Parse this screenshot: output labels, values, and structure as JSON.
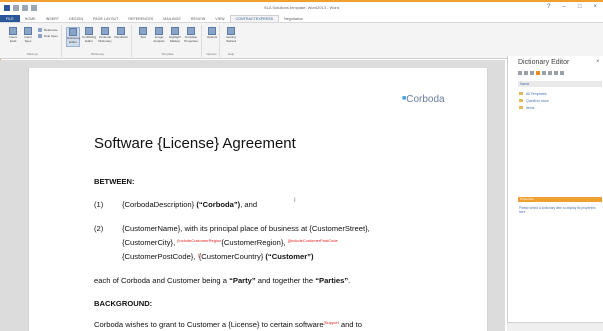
{
  "window": {
    "title": "SLA Solutions template: Word2013 - Word"
  },
  "tabs": [
    "FILE",
    "HOME",
    "INSERT",
    "DESIGN",
    "PAGE LAYOUT",
    "REFERENCES",
    "MAILINGS",
    "REVIEW",
    "VIEW",
    "CONTRACTEXPRESS",
    "Negotiation"
  ],
  "ribbon": {
    "groups": [
      {
        "label": "Mark-up",
        "buttons": [
          "Insert Field",
          "Insert Spec"
        ],
        "small": [
          "Reference",
          "Rule Spec"
        ]
      },
      {
        "label": "Dictionary",
        "buttons": [
          "Dictionary Editor",
          "Conflicting Editor",
          "Personal Dictionary",
          "Republish"
        ]
      },
      {
        "label": "Template",
        "buttons": [
          "Test",
          "Image Analysis",
          "Highlight Markup",
          "Template Properties"
        ]
      },
      {
        "label": "Options",
        "buttons": [
          "Options"
        ]
      },
      {
        "label": "Help",
        "buttons": [
          "Getting Started"
        ]
      }
    ]
  },
  "document": {
    "logo": "Corboda",
    "title": "Software {License} Agreement",
    "between": "BETWEEN:",
    "item1_num": "(1)",
    "item1_pre": "{CorbodaDescription}",
    "item1_quote": "(“Corboda”)",
    "item1_post": ", and",
    "item2_num": "(2)",
    "item2_line1": "{CustomerName}, with its principal place of business at {CustomerStreet},",
    "item2_line2_a": "{CustomerCity},",
    "item2_line2_tag1": "[IncludeCustomerRegion",
    "item2_line2_b": "{CustomerRegion},",
    "item2_line2_tag2": "][IncludeCustomerPostCode",
    "item2_line3_a": "{CustomerPostCode},",
    "item2_line3_tag": "]",
    "item2_line3_b": "{CustomerCountry}",
    "item2_line3_quote": "(“Customer”)",
    "each_pre": "each of Corboda and Customer being a ",
    "each_party": "“Party”",
    "each_mid": " and together the ",
    "each_parties": "“Parties”",
    "each_post": ".",
    "background": "BACKGROUND:",
    "bg_line_pre": "Corboda wishes to grant to Customer a {License} to certain software",
    "bg_line_tag": "[Support",
    "bg_line_post": " and to"
  },
  "pane": {
    "title": "Dictionary Editor",
    "close": "×",
    "header": "Name",
    "items": [
      "All Templates",
      "Question store",
      "Items"
    ],
    "section": "Properties",
    "note": "Please select a dictionary item to display its properties here"
  }
}
